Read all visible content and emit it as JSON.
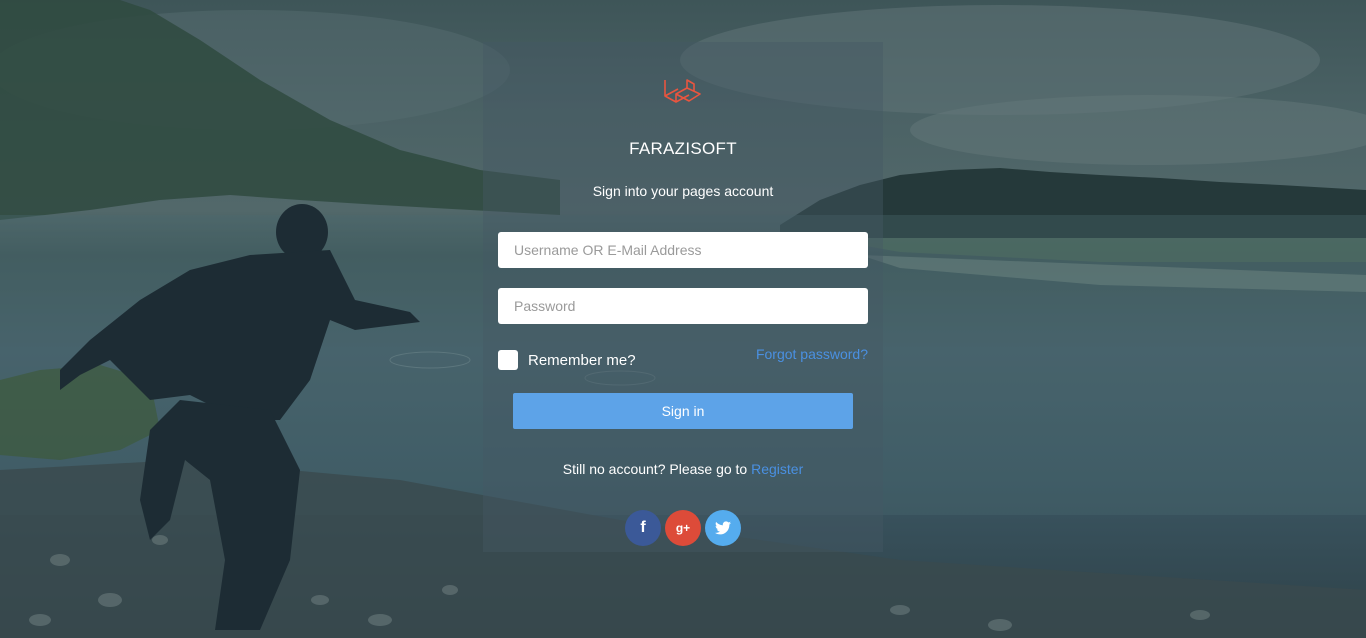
{
  "brand": {
    "name": "FARAZISOFT",
    "logo_icon": "laravel-logo-icon",
    "logo_color": "#e9553f"
  },
  "subtitle": "Sign into your pages account",
  "form": {
    "username_placeholder": "Username OR E-Mail Address",
    "password_placeholder": "Password",
    "remember_label": "Remember me?",
    "forgot_label": "Forgot password?",
    "submit_label": "Sign in"
  },
  "register": {
    "prompt": "Still no account? Please go to ",
    "link_label": "Register"
  },
  "social": [
    {
      "icon": "facebook-icon",
      "glyph": "f",
      "color": "#3b5998"
    },
    {
      "icon": "google-plus-icon",
      "glyph": "g+",
      "color": "#dd4b39"
    },
    {
      "icon": "twitter-icon",
      "glyph": "🐦",
      "color": "#55acee"
    }
  ],
  "colors": {
    "accent": "#4a90e2",
    "button": "#5da3e8"
  }
}
